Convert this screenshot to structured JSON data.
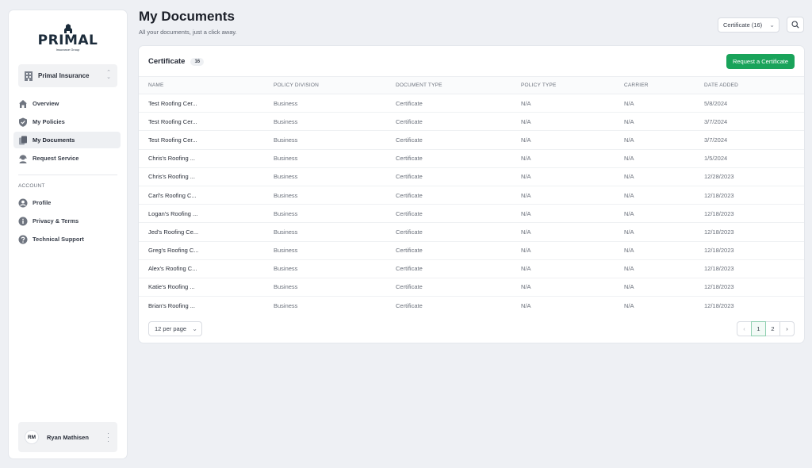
{
  "brand": {
    "name": "PRIMAL",
    "tagline": "Insurance Group"
  },
  "org_select": {
    "label": "Primal Insurance",
    "chevron_icon": "up-down-chevron-icon"
  },
  "nav": [
    {
      "label": "Overview",
      "icon": "home-icon",
      "active": false
    },
    {
      "label": "My Policies",
      "icon": "shield-icon",
      "active": false
    },
    {
      "label": "My Documents",
      "icon": "documents-icon",
      "active": true
    },
    {
      "label": "Request Service",
      "icon": "support-agent-icon",
      "active": false
    }
  ],
  "account": {
    "section_label": "ACCOUNT",
    "items": [
      {
        "label": "Profile",
        "icon": "user-circle-icon"
      },
      {
        "label": "Privacy & Terms",
        "icon": "info-icon"
      },
      {
        "label": "Technical Support",
        "icon": "question-icon"
      }
    ]
  },
  "user": {
    "initials": "RM",
    "name": "Ryan Mathisen"
  },
  "header": {
    "title": "My Documents",
    "subtitle": "All your documents, just a click away.",
    "filter_value": "Certificate (16)"
  },
  "card": {
    "title": "Certificate",
    "count": "16",
    "request_button": "Request a Certificate"
  },
  "table": {
    "columns": [
      "NAME",
      "POLICY DIVISION",
      "DOCUMENT TYPE",
      "POLICY TYPE",
      "CARRIER",
      "DATE ADDED"
    ],
    "rows": [
      [
        "Test Roofing Cer...",
        "Business",
        "Certificate",
        "N/A",
        "N/A",
        "5/8/2024"
      ],
      [
        "Test Roofing Cer...",
        "Business",
        "Certificate",
        "N/A",
        "N/A",
        "3/7/2024"
      ],
      [
        "Test Roofing Cer...",
        "Business",
        "Certificate",
        "N/A",
        "N/A",
        "3/7/2024"
      ],
      [
        "Chris's Roofing ...",
        "Business",
        "Certificate",
        "N/A",
        "N/A",
        "1/5/2024"
      ],
      [
        "Chris's Roofing ...",
        "Business",
        "Certificate",
        "N/A",
        "N/A",
        "12/28/2023"
      ],
      [
        "Carl's Roofing C...",
        "Business",
        "Certificate",
        "N/A",
        "N/A",
        "12/18/2023"
      ],
      [
        "Logan's Roofing ...",
        "Business",
        "Certificate",
        "N/A",
        "N/A",
        "12/18/2023"
      ],
      [
        "Jed's Roofing Ce...",
        "Business",
        "Certificate",
        "N/A",
        "N/A",
        "12/18/2023"
      ],
      [
        "Greg's Roofing C...",
        "Business",
        "Certificate",
        "N/A",
        "N/A",
        "12/18/2023"
      ],
      [
        "Alex's Roofing C...",
        "Business",
        "Certificate",
        "N/A",
        "N/A",
        "12/18/2023"
      ],
      [
        "Katie's Roofing ...",
        "Business",
        "Certificate",
        "N/A",
        "N/A",
        "12/18/2023"
      ],
      [
        "Brian's Roofing ...",
        "Business",
        "Certificate",
        "N/A",
        "N/A",
        "12/18/2023"
      ]
    ]
  },
  "pagination": {
    "per_page": "12 per page",
    "prev": "‹",
    "pages": [
      "1",
      "2"
    ],
    "current": "1",
    "next": "›"
  },
  "colors": {
    "accent": "#19a35a",
    "background": "#eef0f4"
  }
}
